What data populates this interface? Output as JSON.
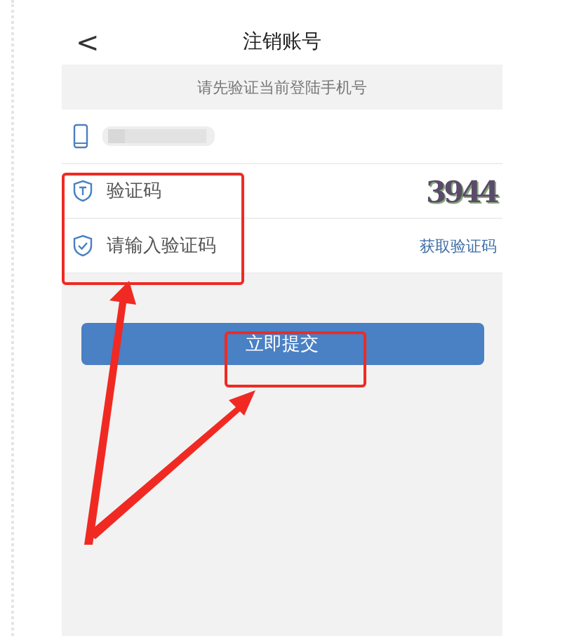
{
  "header": {
    "back": "<",
    "title": "注销账号"
  },
  "notice": "请先验证当前登陆手机号",
  "fields": [
    {
      "kind": "captcha",
      "placeholder": "验证码",
      "captcha": "3944"
    },
    {
      "kind": "sms",
      "placeholder": "请输入验证码",
      "action": "获取验证码"
    }
  ],
  "submit": "立即提交",
  "annotations": [
    {
      "kind": "box"
    },
    {
      "kind": "box"
    },
    {
      "kind": "arrow"
    },
    {
      "kind": "arrow"
    }
  ]
}
